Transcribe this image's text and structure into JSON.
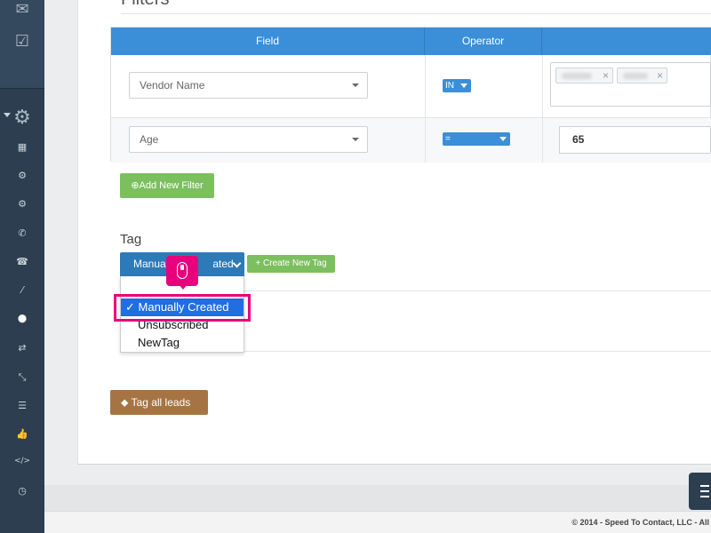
{
  "sidebar": {
    "icons": [
      "envelope-icon",
      "check-square-icon",
      "gear-icon",
      "building-icon",
      "cog-icon",
      "cogs-icon",
      "phone-icon",
      "phone-square-icon",
      "magic-wand-icon",
      "tag-icon",
      "exchange-icon",
      "compress-icon",
      "sliders-icon",
      "thumbs-up-icon",
      "code-icon",
      "clock-icon"
    ],
    "glyphs": [
      "✉",
      "☑",
      "⚙",
      "▦",
      "⚙",
      "⚙",
      "✆",
      "☎",
      "⁄",
      "⬤",
      "⇄",
      "⤡",
      "☰",
      "👍",
      "</>",
      "◷"
    ]
  },
  "filters": {
    "section_title": "Filters",
    "headers": {
      "field": "Field",
      "operator": "Operator",
      "value": ""
    },
    "rows": [
      {
        "field": "Vendor Name",
        "operator": "IN",
        "value": ""
      },
      {
        "field": "Age",
        "operator": "=",
        "value": "65"
      }
    ],
    "add_filter_label": "Add New Filter",
    "plus_icon": "plus-circle-icon"
  },
  "tag": {
    "label": "Tag",
    "selected": "Manually Created",
    "selected_display": "Manual",
    "selected_display_tail": "ated",
    "create_label": "+ Create New Tag",
    "options": [
      "Manually Created",
      "Unsubscribed",
      "NewTag"
    ],
    "check": "✓"
  },
  "tag_all_label": "Tag all leads",
  "footer": {
    "text": "© 2014 - Speed To Contact, LLC - All"
  },
  "colors": {
    "primary": "#3a8fd8",
    "green": "#7cbf5e",
    "brown": "#a67443",
    "highlight": "#e8007d",
    "sidebar": "#2c3e50"
  }
}
